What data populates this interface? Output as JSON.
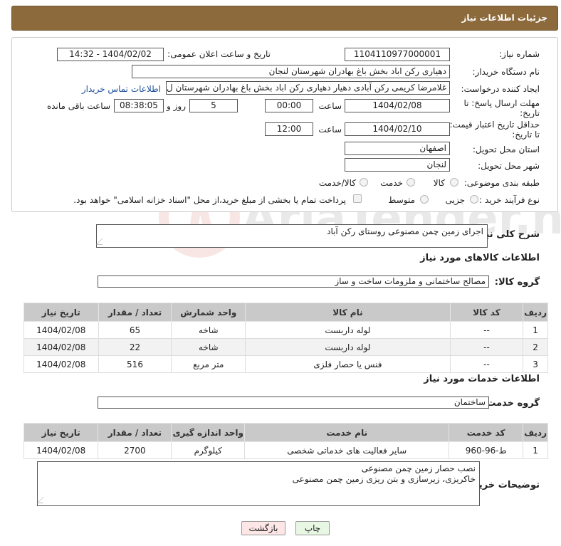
{
  "header": {
    "title": "جزئیات اطلاعات نیاز"
  },
  "form": {
    "need_number_label": "شماره نیاز:",
    "need_number": "1104110977000001",
    "announce_label": "تاریخ و ساعت اعلان عمومی:",
    "announce_value": "1404/02/02 - 14:32",
    "buyer_label": "نام دستگاه خریدار:",
    "buyer_value": "دهیاری رکن اباد بخش باغ بهادران شهرستان لنجان",
    "creator_label": "ایجاد کننده درخواست:",
    "creator_value": "غلامرضا کریمی رکن آبادی دهیار  دهیاری رکن اباد بخش باغ بهادران شهرستان ل",
    "contact_link": "اطلاعات تماس خریدار",
    "deadline_label_1": "مهلت ارسال پاسخ: تا",
    "deadline_label_2": "تاریخ:",
    "deadline_date": "1404/02/08",
    "time_label": "ساعت",
    "deadline_time": "00:00",
    "days_value": "5",
    "days_label": "روز و",
    "remaining_time": "08:38:05",
    "remaining_label": "ساعت باقی مانده",
    "min_price_label_1": "حداقل تاریخ اعتبار قیمت:",
    "min_price_label_2": "تا تاریخ:",
    "min_price_date": "1404/02/10",
    "min_price_time": "12:00",
    "province_label": "استان محل تحویل:",
    "province_value": "اصفهان",
    "city_label": "شهر محل تحویل:",
    "city_value": "لنجان",
    "category_label": "طبقه بندی موضوعی:",
    "category_options": [
      "کالا",
      "خدمت",
      "کالا/خدمت"
    ],
    "process_label": "نوع فرآیند خرید :",
    "process_options": [
      "جزیی",
      "متوسط"
    ],
    "payment_note": "پرداخت تمام یا بخشی از مبلغ خرید،از محل \"اسناد خزانه اسلامی\" خواهد بود."
  },
  "description": {
    "label": "شرح کلی نیاز:",
    "value": "اجرای زمین چمن مصنوعی روستای رکن آباد"
  },
  "goods": {
    "section_title": "اطلاعات کالاهای مورد نیاز",
    "group_label": "گروه کالا:",
    "group_value": "مصالح ساختمانی و ملزومات ساخت و ساز",
    "columns": [
      "ردیف",
      "کد کالا",
      "نام کالا",
      "واحد شمارش",
      "تعداد / مقدار",
      "تاریخ نیاز"
    ],
    "rows": [
      [
        "1",
        "--",
        "لوله داربست",
        "شاخه",
        "65",
        "1404/02/08"
      ],
      [
        "2",
        "--",
        "لوله داربست",
        "شاخه",
        "22",
        "1404/02/08"
      ],
      [
        "3",
        "--",
        "فنس یا حصار فلزی",
        "متر مربع",
        "516",
        "1404/02/08"
      ]
    ]
  },
  "services": {
    "section_title": "اطلاعات خدمات مورد نیاز",
    "group_label": "گروه خدمت:",
    "group_value": "ساختمان",
    "columns": [
      "ردیف",
      "کد خدمت",
      "نام خدمت",
      "واحد اندازه گیری",
      "تعداد / مقدار",
      "تاریخ نیاز"
    ],
    "rows": [
      [
        "1",
        "ط-96-960",
        "سایر فعالیت های خدماتی شخصی",
        "کیلوگرم",
        "2700",
        "1404/02/08"
      ]
    ]
  },
  "buyer_notes": {
    "label": "توضیحات خریدار:",
    "line1": "نصب حصار زمین چمن مصنوعی",
    "line2": "خاکریزی، زیرسازی و بتن ریزی زمین چمن مصنوعی"
  },
  "buttons": {
    "print": "چاپ",
    "back": "بازگشت"
  },
  "watermark": {
    "text": "AriaTender.neT"
  },
  "colors": {
    "header_bg": "#8d6a3c",
    "table_header_bg": "#c9c9c9",
    "back_button_bg": "#fde6e6",
    "print_button_bg": "#e8f7e3",
    "link": "#1a4f9b"
  }
}
